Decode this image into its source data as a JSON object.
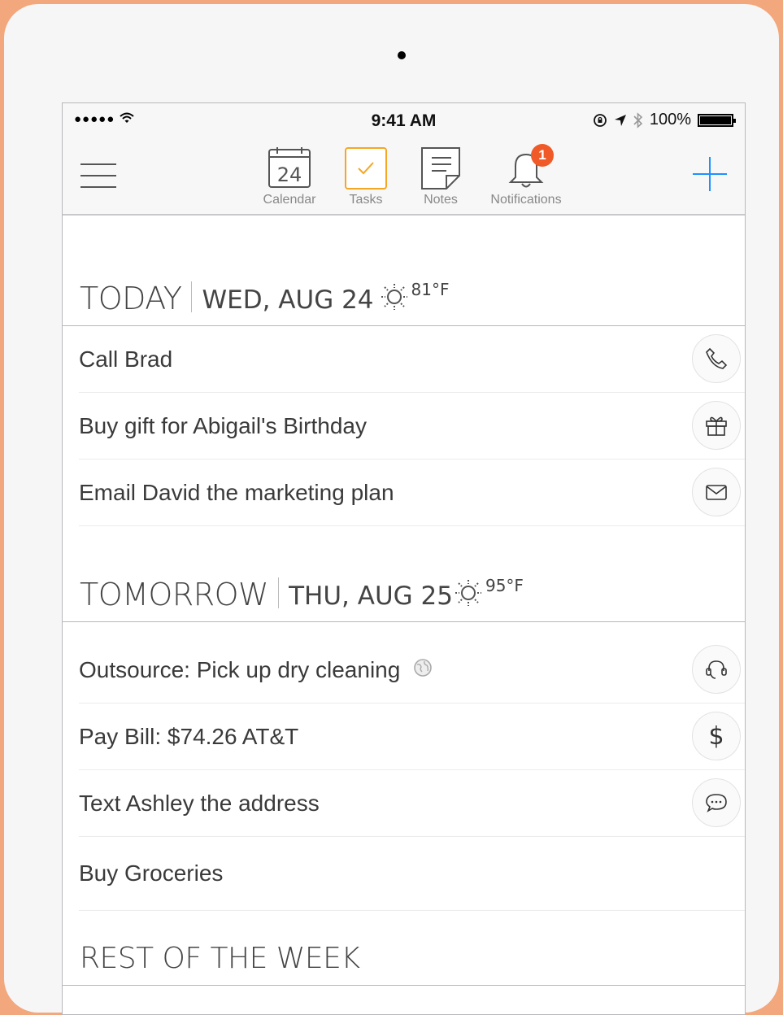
{
  "status_bar": {
    "signal": "●●●●● ",
    "time": "9:41 AM",
    "battery_pct": "100%"
  },
  "toolbar": {
    "tabs": [
      {
        "label": "Calendar",
        "icon": "calendar-icon",
        "calendar_day": "24"
      },
      {
        "label": "Tasks",
        "icon": "checkbox-icon",
        "accent": "#f5a623"
      },
      {
        "label": "Notes",
        "icon": "note-icon"
      },
      {
        "label": "Notifications",
        "icon": "bell-icon",
        "badge": "1",
        "badge_color": "#f05a28"
      }
    ],
    "add_button_color": "#1e90ff"
  },
  "sections": [
    {
      "day": "TODAY",
      "date": "WED, AUG 24",
      "weather_icon": "sun-icon",
      "temp": "81°F",
      "tasks": [
        {
          "label": "Call Brad",
          "action_icon": "phone-icon"
        },
        {
          "label": "Buy gift for Abigail's Birthday",
          "action_icon": "gift-icon"
        },
        {
          "label": "Email David the marketing plan",
          "action_icon": "mail-icon"
        }
      ]
    },
    {
      "day": "TOMORROW",
      "date": "THU, AUG 25",
      "weather_icon": "sun-icon",
      "temp": "95°F",
      "tasks": [
        {
          "label": "Outsource: Pick up dry cleaning",
          "action_icon": "headset-icon",
          "extra_icon": "globe-icon"
        },
        {
          "label": "Pay Bill: $74.26 AT&T",
          "action_icon": "dollar-icon"
        },
        {
          "label": "Text Ashley the address",
          "action_icon": "chat-icon"
        },
        {
          "label": "Buy Groceries"
        }
      ]
    },
    {
      "day": "REST OF THE WEEK"
    }
  ]
}
